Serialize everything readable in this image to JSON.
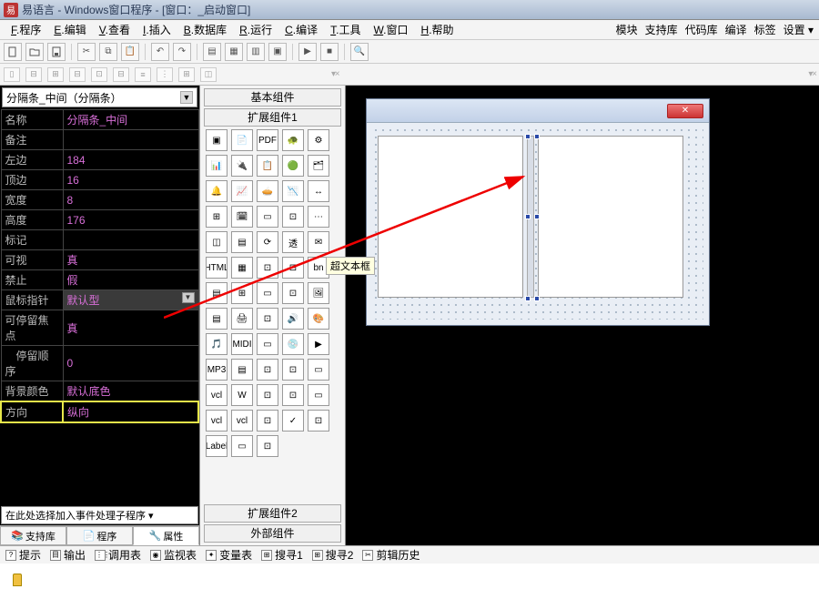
{
  "title": "易语言 - Windows窗口程序 - [窗口：_启动窗口]",
  "menu": {
    "f": "程序",
    "e": "编辑",
    "v": "查看",
    "i": "插入",
    "b": "数据库",
    "r": "运行",
    "c": "编译",
    "t": "工具",
    "w": "窗口",
    "h": "帮助"
  },
  "menuRight": [
    "模块",
    "支持库",
    "代码库",
    "编译",
    "标签",
    "设置 ▾"
  ],
  "propCombo": "分隔条_中间（分隔条）",
  "props": [
    {
      "k": "名称",
      "v": "分隔条_中间"
    },
    {
      "k": "备注",
      "v": ""
    },
    {
      "k": "左边",
      "v": "184"
    },
    {
      "k": "顶边",
      "v": "16"
    },
    {
      "k": "宽度",
      "v": "8"
    },
    {
      "k": "高度",
      "v": "176"
    },
    {
      "k": "标记",
      "v": ""
    },
    {
      "k": "可视",
      "v": "真"
    },
    {
      "k": "禁止",
      "v": "假"
    },
    {
      "k": "鼠标指针",
      "v": "默认型",
      "dd": true,
      "sel": true
    },
    {
      "k": "可停留焦点",
      "v": "真"
    },
    {
      "k": "停留顺序",
      "v": "0",
      "indent": true
    },
    {
      "k": "背景颜色",
      "v": "默认底色"
    },
    {
      "k": "方向",
      "v": "纵向",
      "hl": true
    }
  ],
  "eventCombo": "在此处选择加入事件处理子程序 ▾",
  "leftTabs": [
    "支持库",
    "程序",
    "属性"
  ],
  "mid": {
    "cat1": "基本组件",
    "cat2": "扩展组件1",
    "cat3": "扩展组件2",
    "cat4": "外部组件"
  },
  "tooltip": "超文本框",
  "bottomTabs": [
    "提示",
    "输出",
    "调用表",
    "监视表",
    "变量表",
    "搜寻1",
    "搜寻2",
    "剪辑历史"
  ]
}
